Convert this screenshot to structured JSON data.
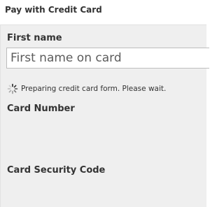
{
  "dialog": {
    "title": "Pay with Credit Card"
  },
  "form": {
    "first_name": {
      "label": "First name",
      "placeholder": "First name on card",
      "value": ""
    },
    "loading": {
      "icon": "spinner-icon",
      "text": "Preparing credit card form. Please wait."
    },
    "card_number": {
      "label": "Card Number"
    },
    "security_code": {
      "label": "Card Security Code"
    }
  },
  "colors": {
    "panel_background": "#efefef",
    "label_text": "#333333",
    "input_border": "#bdbdbd"
  }
}
